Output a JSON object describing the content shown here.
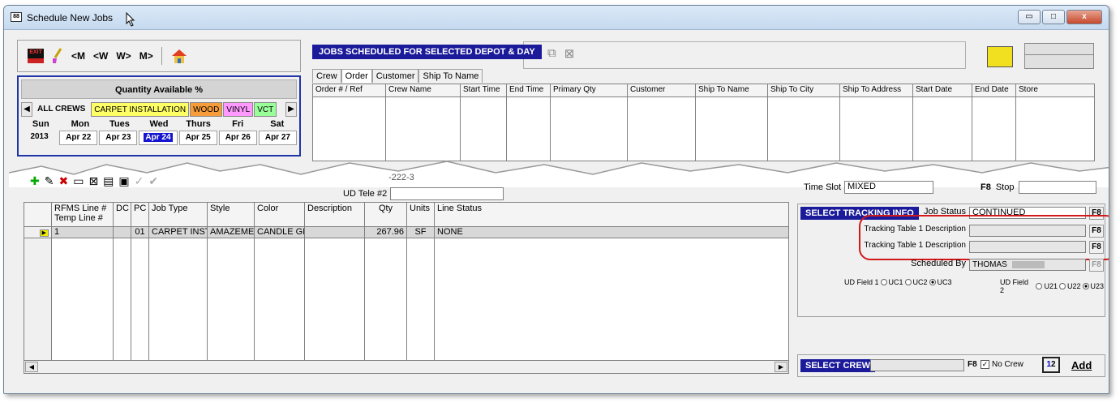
{
  "window": {
    "title": "Schedule New Jobs",
    "controls": {
      "minimize": "▭",
      "maximize": "□",
      "close": "x"
    }
  },
  "toolbar": {
    "exit_label": "EXIT",
    "nav": [
      "<M",
      "<W",
      "W>",
      "M>"
    ]
  },
  "calendar": {
    "header": "Quantity Available %",
    "crew_tabs": [
      {
        "label": "ALL CREWS",
        "color": ""
      },
      {
        "label": "CARPET INSTALLATION",
        "color": "#ffff66"
      },
      {
        "label": "WOOD",
        "color": "#f79c3a"
      },
      {
        "label": "VINYL",
        "color": "#ff99ff"
      },
      {
        "label": "VCT",
        "color": "#99ff99"
      }
    ],
    "days": [
      "Sun",
      "Mon",
      "Tues",
      "Wed",
      "Thurs",
      "Fri",
      "Sat"
    ],
    "dates": [
      "2013",
      "Apr 22",
      "Apr 23",
      "Apr 24",
      "Apr 25",
      "Apr 26",
      "Apr 27"
    ],
    "selected_date": "Apr 24"
  },
  "jobs": {
    "header": "JOBS SCHEDULED FOR SELECTED DEPOT & DAY",
    "tabs": [
      "Crew",
      "Order",
      "Customer",
      "Ship To Name"
    ],
    "active_tab": "Order",
    "columns": [
      "Order # / Ref",
      "Crew Name",
      "Start Time",
      "End Time",
      "Primary Qty",
      "Customer",
      "Ship To Name",
      "Ship To City",
      "Ship To Address",
      "Start Date",
      "End Date",
      "Store"
    ]
  },
  "lines": {
    "ud_tele_label": "UD Tele #2",
    "partial_value": "-222-3",
    "columns": [
      "RFMS Line #\nTemp Line #",
      "DC",
      "PC",
      "Job Type",
      "Style",
      "Color",
      "Description",
      "Qty",
      "Units",
      "Line Status"
    ],
    "rows": [
      {
        "line": "1",
        "dc": "",
        "pc": "01",
        "job_type": "CARPET INSTA",
        "style": "AMAZEMEN",
        "color": "CANDLE GL",
        "description": "",
        "qty": "267.96",
        "units": "SF",
        "status": "NONE"
      }
    ]
  },
  "right_panel": {
    "time_slot_label": "Time Slot",
    "time_slot_value": "MIXED",
    "stop_label": "Stop",
    "select_tracking": "SELECT TRACKING INFO",
    "job_status_label": "Job Status",
    "job_status_value": "CONTINUED",
    "tracking_1_label": "Tracking Table 1 Description",
    "tracking_2_label": "Tracking Table 1 Description",
    "scheduled_by_label": "Scheduled By",
    "scheduled_by_value": "THOMAS",
    "ud_field_1_label": "UD Field 1",
    "ud_field_1_options": [
      "UC1",
      "UC2",
      "UC3"
    ],
    "ud_field_2_label": "UD Field 2",
    "ud_field_2_options": [
      "U21",
      "U22",
      "U23"
    ],
    "f8": "F8",
    "select_crew": "SELECT CREW",
    "no_crew_label": "No Crew",
    "add_label": "Add"
  }
}
